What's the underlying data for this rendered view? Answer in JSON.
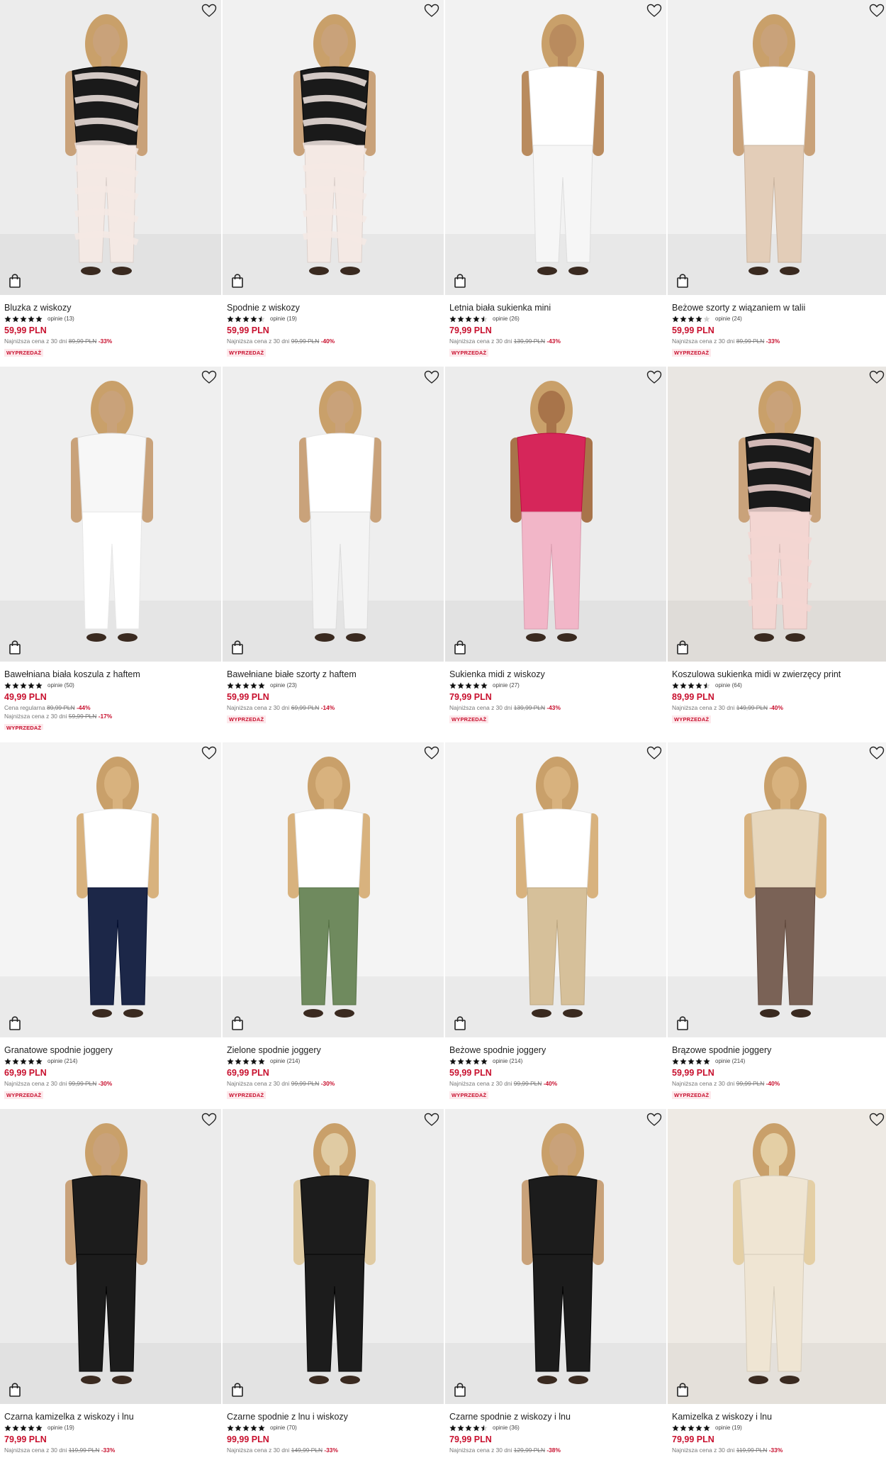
{
  "icons": {
    "wishlist": "heart-outline-icon",
    "cart": "shopping-bag-icon",
    "rating": "star-icon"
  },
  "colors": {
    "price": "#c8102e",
    "badge_bg": "#fde9ec",
    "badge_text": "#c8102e"
  },
  "products": [
    {
      "name": "Bluzka z wiskozy",
      "stars": 5,
      "reviews": "opinie (13)",
      "price": "59,99 PLN",
      "lowest_label": "Najniższa cena z 30 dni",
      "lowest_old": "89,99 PLN",
      "lowest_disc": "-33%",
      "badge": "WYPRZEDAŻ",
      "palette": [
        "#ececec",
        "#1a1a1a",
        "#f4e9e4",
        "#c9a27a"
      ]
    },
    {
      "name": "Spodnie z wiskozy",
      "stars": 4.5,
      "reviews": "opinie (19)",
      "price": "59,99 PLN",
      "lowest_label": "Najniższa cena z 30 dni",
      "lowest_old": "99,99 PLN",
      "lowest_disc": "-40%",
      "badge": "WYPRZEDAŻ",
      "palette": [
        "#f1f1f1",
        "#1a1a1a",
        "#f4e9e4",
        "#c9a27a"
      ]
    },
    {
      "name": "Letnia biała sukienka mini",
      "stars": 4.5,
      "reviews": "opinie (26)",
      "price": "79,99 PLN",
      "lowest_label": "Najniższa cena z 30 dni",
      "lowest_old": "139,99 PLN",
      "lowest_disc": "-43%",
      "badge": "WYPRZEDAŻ",
      "palette": [
        "#f2f2f2",
        "#ffffff",
        "#f6f6f6",
        "#b98b5e"
      ]
    },
    {
      "name": "Beżowe szorty z wiązaniem w talii",
      "stars": 4,
      "reviews": "opinie (24)",
      "price": "59,99 PLN",
      "lowest_label": "Najniższa cena z 30 dni",
      "lowest_old": "89,99 PLN",
      "lowest_disc": "-33%",
      "badge": "WYPRZEDAŻ",
      "palette": [
        "#f0f0f0",
        "#ffffff",
        "#e3cdb8",
        "#c9a27a"
      ]
    },
    {
      "name": "Bawełniana biała koszula z haftem",
      "stars": 5,
      "reviews": "opinie (50)",
      "price": "49,99 PLN",
      "regular_label": "Cena regularna",
      "regular_old": "89,99 PLN",
      "regular_disc": "-44%",
      "lowest_label": "Najniższa cena z 30 dni",
      "lowest_old": "59,99 PLN",
      "lowest_disc": "-17%",
      "badge": "WYPRZEDAŻ",
      "palette": [
        "#efefef",
        "#f7f7f7",
        "#ffffff",
        "#c9a27a"
      ]
    },
    {
      "name": "Bawełniane białe szorty z haftem",
      "stars": 5,
      "reviews": "opinie (23)",
      "price": "59,99 PLN",
      "lowest_label": "Najniższa cena z 30 dni",
      "lowest_old": "69,99 PLN",
      "lowest_disc": "-14%",
      "badge": "WYPRZEDAŻ",
      "palette": [
        "#eeeeee",
        "#ffffff",
        "#f4f4f4",
        "#c9a27a"
      ]
    },
    {
      "name": "Sukienka midi z wiskozy",
      "stars": 5,
      "reviews": "opinie (27)",
      "price": "79,99 PLN",
      "lowest_label": "Najniższa cena z 30 dni",
      "lowest_old": "139,99 PLN",
      "lowest_disc": "-43%",
      "badge": "WYPRZEDAŻ",
      "palette": [
        "#ececec",
        "#d6265a",
        "#f2b6c8",
        "#a8744a"
      ]
    },
    {
      "name": "Koszulowa sukienka midi w zwierzęcy print",
      "stars": 4.5,
      "reviews": "opinie (64)",
      "price": "89,99 PLN",
      "lowest_label": "Najniższa cena z 30 dni",
      "lowest_old": "149,99 PLN",
      "lowest_disc": "-40%",
      "badge": "WYPRZEDAŻ",
      "palette": [
        "#e9e6e2",
        "#1a1a1a",
        "#f3d6d2",
        "#c9a27a"
      ]
    },
    {
      "name": "Granatowe spodnie joggery",
      "stars": 5,
      "reviews": "opinie (214)",
      "price": "69,99 PLN",
      "lowest_label": "Najniższa cena z 30 dni",
      "lowest_old": "99,99 PLN",
      "lowest_disc": "-30%",
      "badge": "WYPRZEDAŻ",
      "palette": [
        "#f4f4f4",
        "#ffffff",
        "#1c2748",
        "#d8b27e"
      ]
    },
    {
      "name": "Zielone spodnie joggery",
      "stars": 5,
      "reviews": "opinie (214)",
      "price": "69,99 PLN",
      "lowest_label": "Najniższa cena z 30 dni",
      "lowest_old": "99,99 PLN",
      "lowest_disc": "-30%",
      "badge": "WYPRZEDAŻ",
      "palette": [
        "#f4f4f4",
        "#ffffff",
        "#6f8a5e",
        "#d8b27e"
      ]
    },
    {
      "name": "Beżowe spodnie joggery",
      "stars": 5,
      "reviews": "opinie (214)",
      "price": "59,99 PLN",
      "lowest_label": "Najniższa cena z 30 dni",
      "lowest_old": "99,99 PLN",
      "lowest_disc": "-40%",
      "badge": "WYPRZEDAŻ",
      "palette": [
        "#f4f4f4",
        "#ffffff",
        "#d6c09a",
        "#d8b27e"
      ]
    },
    {
      "name": "Brązowe spodnie joggery",
      "stars": 5,
      "reviews": "opinie (214)",
      "price": "59,99 PLN",
      "lowest_label": "Najniższa cena z 30 dni",
      "lowest_old": "99,99 PLN",
      "lowest_disc": "-40%",
      "badge": "WYPRZEDAŻ",
      "palette": [
        "#f4f4f4",
        "#e7d7bd",
        "#7a6256",
        "#d8b27e"
      ]
    },
    {
      "name": "Czarna kamizelka z wiskozy i lnu",
      "stars": 5,
      "reviews": "opinie (19)",
      "price": "79,99 PLN",
      "lowest_label": "Najniższa cena z 30 dni",
      "lowest_old": "119,99 PLN",
      "lowest_disc": "-33%",
      "palette": [
        "#ebebeb",
        "#1c1c1c",
        "#1c1c1c",
        "#c9a27a"
      ]
    },
    {
      "name": "Czarne spodnie z lnu i wiskozy",
      "stars": 5,
      "reviews": "opinie (70)",
      "price": "99,99 PLN",
      "lowest_label": "Najniższa cena z 30 dni",
      "lowest_old": "149,99 PLN",
      "lowest_disc": "-33%",
      "palette": [
        "#ededed",
        "#1c1c1c",
        "#1c1c1c",
        "#e0cba3"
      ]
    },
    {
      "name": "Czarne spodnie z wiskozy i lnu",
      "stars": 4.5,
      "reviews": "opinie (36)",
      "price": "79,99 PLN",
      "lowest_label": "Najniższa cena z 30 dni",
      "lowest_old": "129,99 PLN",
      "lowest_disc": "-38%",
      "palette": [
        "#efefef",
        "#1c1c1c",
        "#1c1c1c",
        "#c9a27a"
      ]
    },
    {
      "name": "Kamizelka z wiskozy i lnu",
      "stars": 5,
      "reviews": "opinie (19)",
      "price": "79,99 PLN",
      "lowest_label": "Najniższa cena z 30 dni",
      "lowest_old": "119,99 PLN",
      "lowest_disc": "-33%",
      "palette": [
        "#eeeae4",
        "#efe5d3",
        "#efe5d3",
        "#e4cfa5"
      ]
    }
  ]
}
